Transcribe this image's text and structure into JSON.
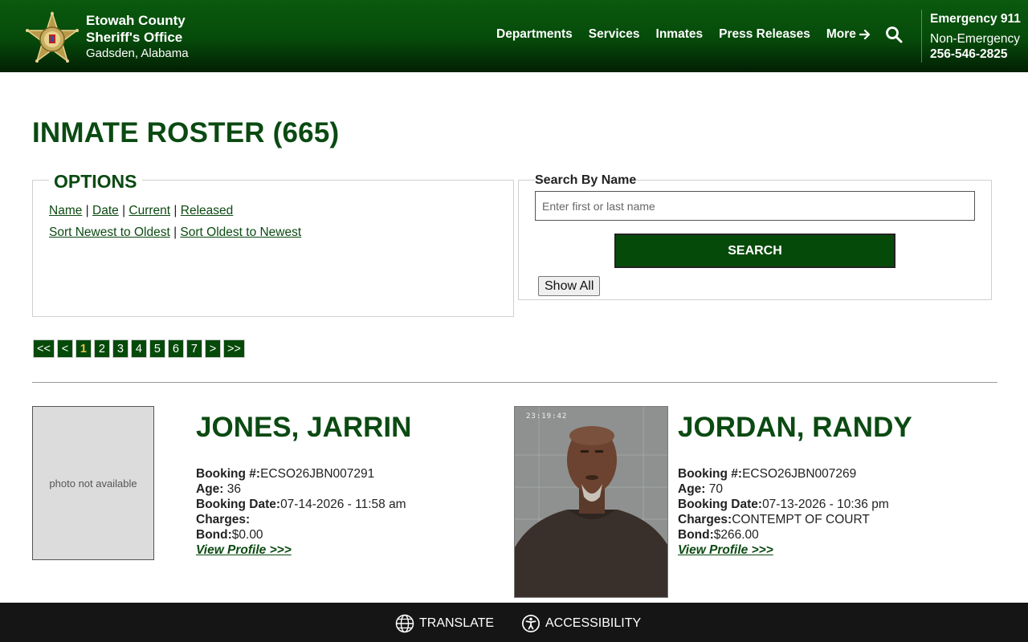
{
  "header": {
    "brand_line1": "Etowah County",
    "brand_line2": "Sheriff's Office",
    "brand_line3": "Gadsden, Alabama",
    "nav": [
      "Departments",
      "Services",
      "Inmates",
      "Press Releases",
      "More"
    ],
    "emergency": "Emergency 911",
    "non_emergency_label": "Non-Emergency",
    "non_emergency_phone": "256-546-2825",
    "icons": [
      "sheriff-star-logo",
      "arrow-right-icon",
      "search-icon"
    ]
  },
  "page": {
    "title": "INMATE ROSTER (665)"
  },
  "options": {
    "legend": "OPTIONS",
    "filters": [
      "Name",
      "Date",
      "Current",
      "Released"
    ],
    "sorts": [
      "Sort Newest to Oldest",
      "Sort Oldest to Newest"
    ],
    "separator": "|"
  },
  "search": {
    "label": "Search By Name",
    "placeholder": "Enter first or last name",
    "button": "SEARCH",
    "show_all": "Show All"
  },
  "pager": {
    "items": [
      "<<",
      "<",
      "1",
      "2",
      "3",
      "4",
      "5",
      "6",
      "7",
      ">",
      ">>"
    ],
    "current": "1"
  },
  "inmates": [
    {
      "name": "JONES, JARRIN",
      "photo_text": "photo not available",
      "booking_label": "Booking #:",
      "booking": "ECSO26JBN007291",
      "age_label": "Age:",
      "age": "36",
      "date_label": "Booking Date:",
      "date": "07-14-2026 - 11:58 am",
      "charges_label": "Charges:",
      "charges": "",
      "bond_label": "Bond:",
      "bond": "$0.00",
      "profile": "View Profile >>>"
    },
    {
      "name": "JORDAN, RANDY",
      "photo_stamp": "23:19:42",
      "booking_label": "Booking #:",
      "booking": "ECSO26JBN007269",
      "age_label": "Age:",
      "age": "70",
      "date_label": "Booking Date:",
      "date": "07-13-2026 - 10:36 pm",
      "charges_label": "Charges:",
      "charges": "CONTEMPT OF COURT",
      "bond_label": "Bond:",
      "bond": "$266.00",
      "profile": "View Profile >>>"
    }
  ],
  "footer": {
    "translate": "TRANSLATE",
    "accessibility": "ACCESSIBILITY"
  },
  "colors": {
    "brand_green": "#064a0a",
    "title_green": "#0b4a12",
    "pager_current": "#e8c24a",
    "footer_bg": "#151515"
  }
}
